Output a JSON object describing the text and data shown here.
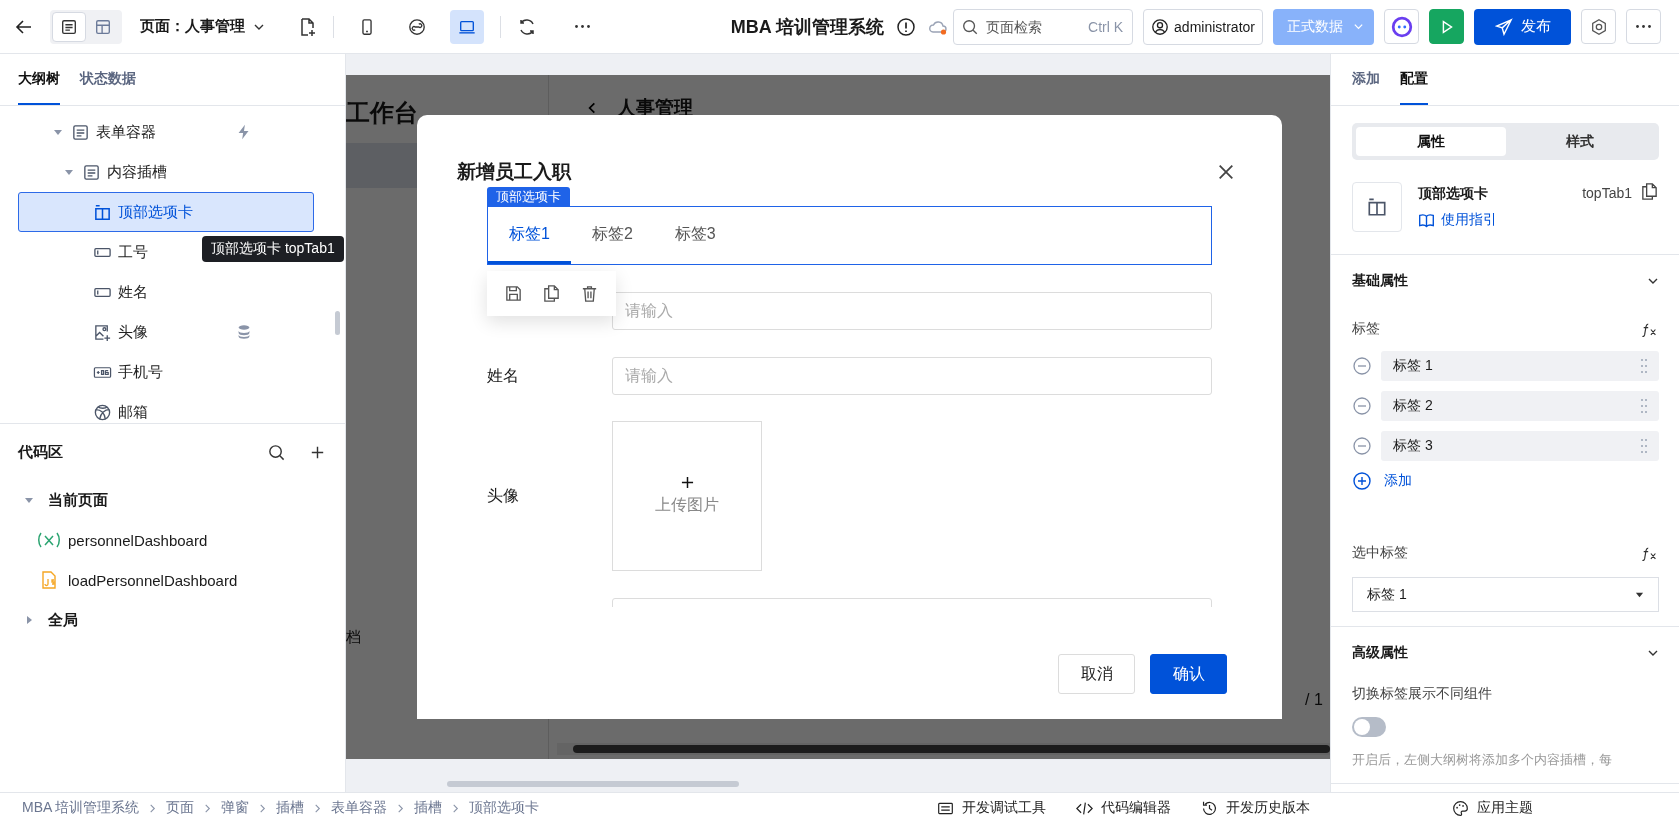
{
  "topbar": {
    "view_modes": [
      {
        "kind": "outline",
        "selected": true
      },
      {
        "kind": "layout",
        "selected": false
      }
    ],
    "page_label": "页面：人事管理",
    "devices": [
      {
        "kind": "mobile",
        "selected": false
      },
      {
        "kind": "miniapp",
        "selected": false
      },
      {
        "kind": "desktop",
        "selected": true
      }
    ],
    "app_title": "MBA 培训管理系统",
    "search": {
      "placeholder": "页面检索",
      "shortcut": "Ctrl K"
    },
    "user": "administrator",
    "data_env": "正式数据",
    "publish": "发布"
  },
  "left_panel": {
    "tabs": [
      {
        "label": "大纲树",
        "selected": true
      },
      {
        "label": "状态数据",
        "selected": false
      }
    ],
    "tree": [
      {
        "label": "表单容器",
        "kind": "form",
        "badge": {
          "kind": "event"
        },
        "selected": false,
        "expanded": true,
        "children": [
          {
            "label": "内容插槽",
            "kind": "form",
            "selected": false,
            "expanded": true,
            "children": [
              {
                "label": "顶部选项卡",
                "kind": "tabs",
                "selected": true
              },
              {
                "label": "工号",
                "kind": "input",
                "selected": false
              },
              {
                "label": "姓名",
                "kind": "input",
                "selected": false
              },
              {
                "label": "头像",
                "kind": "image",
                "badge": {
                  "kind": "data"
                },
                "selected": false
              },
              {
                "label": "手机号",
                "kind": "phone",
                "selected": false
              },
              {
                "label": "邮箱",
                "kind": "email",
                "selected": false
              }
            ]
          }
        ]
      }
    ],
    "tooltip": "顶部选项卡 topTab1",
    "code_area": {
      "title": "代码区",
      "groups": [
        {
          "label": "当前页面",
          "expanded": true,
          "children": [
            {
              "label": "personnelDashboard",
              "kind": "variable"
            },
            {
              "label": "loadPersonnelDashboard",
              "kind": "script"
            }
          ]
        },
        {
          "label": "全局",
          "expanded": false
        }
      ]
    }
  },
  "canvas": {
    "background_page": {
      "sidebar_title": "工作台",
      "page_title": "人事管理",
      "footer_text": "档",
      "pager": "/ 1"
    },
    "modal": {
      "title": "新增员工入职",
      "tabs_component": {
        "tag": "顶部选项卡",
        "tabs": [
          {
            "label": "标签1",
            "selected": true
          },
          {
            "label": "标签2",
            "selected": false
          },
          {
            "label": "标签3",
            "selected": false
          }
        ]
      },
      "fields": [
        {
          "kind": "input",
          "placeholder": "请输入"
        },
        {
          "kind": "input",
          "label": "姓名",
          "placeholder": "请输入"
        },
        {
          "kind": "upload",
          "label": "头像",
          "upload_text": "上传图片"
        },
        {
          "kind": "input"
        }
      ],
      "buttons": [
        {
          "label": "取消",
          "primary": false
        },
        {
          "label": "确认",
          "primary": true
        }
      ]
    }
  },
  "right_panel": {
    "tabs": [
      {
        "label": "添加",
        "selected": false
      },
      {
        "label": "配置",
        "selected": true
      }
    ],
    "segments": [
      {
        "label": "属性",
        "selected": true
      },
      {
        "label": "样式",
        "selected": false
      }
    ],
    "component": {
      "name": "顶部选项卡",
      "guide_link": "使用指引",
      "id": "topTab1"
    },
    "basic": {
      "title": "基础属性",
      "expanded": true,
      "tags_label": "标签",
      "tags": [
        "标签 1",
        "标签 2",
        "标签 3"
      ],
      "add_label": "添加",
      "selected_label": "选中标签",
      "selected_value": "标签 1"
    },
    "advanced": {
      "title": "高级属性",
      "expanded": true,
      "switch_label": "切换标签展示不同组件",
      "switch_on": false,
      "hint": "开启后，左侧大纲树将添加多个内容插槽，每"
    }
  },
  "status_bar": {
    "breadcrumbs": [
      "MBA 培训管理系统",
      "页面",
      "弹窗",
      "插槽",
      "表单容器",
      "插槽",
      "顶部选项卡"
    ],
    "tools": [
      {
        "label": "开发调试工具",
        "kind": "debug"
      },
      {
        "label": "代码编辑器",
        "kind": "code"
      },
      {
        "label": "开发历史版本",
        "kind": "history"
      },
      {
        "label": "应用主题",
        "kind": "theme"
      }
    ]
  }
}
